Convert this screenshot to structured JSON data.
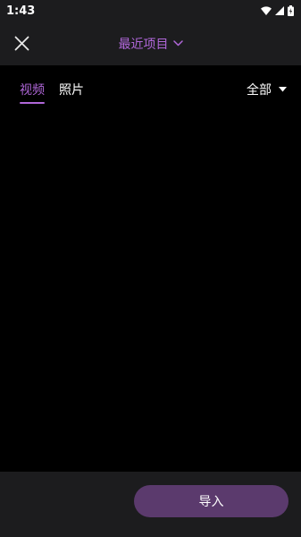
{
  "status_bar": {
    "time": "1:43",
    "icons": [
      "wifi-icon",
      "signal-icon",
      "battery-icon"
    ]
  },
  "header": {
    "close_icon": "close-icon",
    "title": "最近项目",
    "title_icon": "chevron-down-icon"
  },
  "tabs": [
    {
      "label": "视频",
      "selected": true
    },
    {
      "label": "照片",
      "selected": false
    }
  ],
  "filter": {
    "value": "全部",
    "icon": "caret-down-icon"
  },
  "footer": {
    "import_label": "导入"
  },
  "colors": {
    "accent": "#b067d9",
    "bar_background": "#1c1c1e",
    "import_button": "#5b3a6d"
  }
}
